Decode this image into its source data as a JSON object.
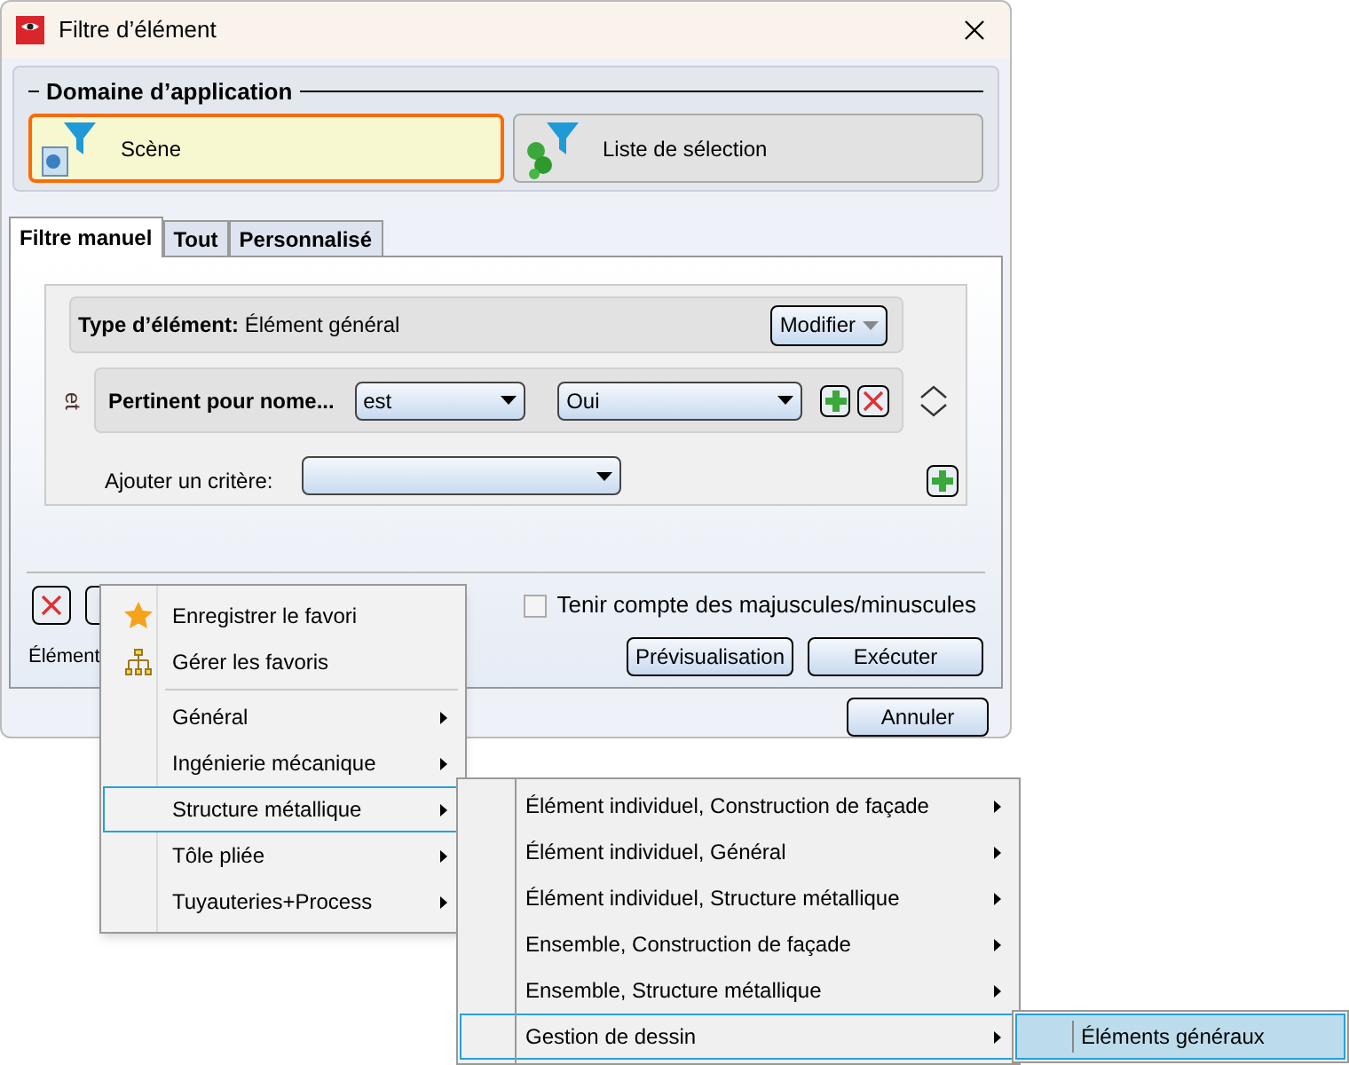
{
  "window": {
    "title": "Filtre d’élément"
  },
  "application_domain": {
    "title": "Domaine d’application",
    "options": [
      {
        "label": "Scène",
        "selected": true
      },
      {
        "label": "Liste de sélection",
        "selected": false
      }
    ]
  },
  "tabs": [
    {
      "label": "Filtre manuel",
      "selected": true
    },
    {
      "label": "Tout",
      "selected": false
    },
    {
      "label": "Personnalisé",
      "selected": false
    }
  ],
  "criteria": {
    "type_label": "Type d’élément:",
    "type_value": "Élément général",
    "modify_button": "Modifier",
    "conjunction": "et",
    "criterion": {
      "field": "Pertinent pour nome...",
      "operator": "est",
      "value": "Oui"
    },
    "add_label": "Ajouter un critère:"
  },
  "case_sensitive": {
    "label": "Tenir compte des majuscules/minuscules",
    "checked": false
  },
  "elements_label": "Élément",
  "buttons": {
    "preview": "Prévisualisation",
    "execute": "Exécuter",
    "cancel": "Annuler"
  },
  "context_menu": [
    {
      "label": "Enregistrer le favori",
      "kind": "save",
      "selected": false
    },
    {
      "label": "Gérer les favoris",
      "kind": "manage",
      "selected": false
    },
    {
      "label": "Général",
      "kind": "submenu",
      "selected": false
    },
    {
      "label": "Ingénierie mécanique",
      "kind": "submenu",
      "selected": false
    },
    {
      "label": "Structure métallique",
      "kind": "submenu",
      "selected": true
    },
    {
      "label": "Tôle pliée",
      "kind": "submenu",
      "selected": false
    },
    {
      "label": "Tuyauteries+Process",
      "kind": "submenu",
      "selected": false
    }
  ],
  "submenu": [
    {
      "label": "Élément individuel, Construction de façade",
      "selected": false
    },
    {
      "label": "Élément individuel, Général",
      "selected": false
    },
    {
      "label": "Élément individuel, Structure métallique",
      "selected": false
    },
    {
      "label": "Ensemble, Construction de façade",
      "selected": false
    },
    {
      "label": "Ensemble, Structure métallique",
      "selected": false
    },
    {
      "label": "Gestion de dessin",
      "selected": true
    }
  ],
  "submenu_2": [
    {
      "label": "Éléments généraux",
      "selected": true
    }
  ]
}
